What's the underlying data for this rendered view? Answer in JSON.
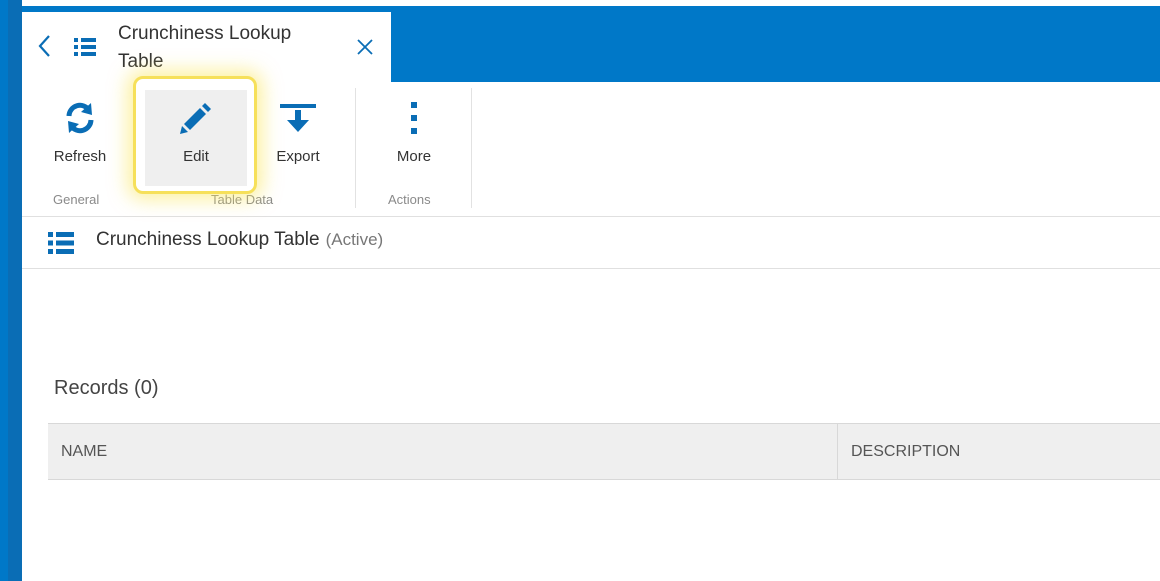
{
  "tab": {
    "title": "Crunchiness Lookup Table"
  },
  "ribbon": {
    "buttons": [
      {
        "label": "Refresh",
        "icon": "refresh-icon"
      },
      {
        "label": "Edit",
        "icon": "pencil-icon"
      },
      {
        "label": "Export",
        "icon": "export-icon"
      },
      {
        "label": "More",
        "icon": "more-vertical-icon"
      }
    ],
    "groups": [
      "General",
      "Table Data",
      "Actions"
    ]
  },
  "subheader": {
    "title": "Crunchiness Lookup Table",
    "status": "(Active)"
  },
  "records": {
    "title": "Records (0)",
    "columns": [
      "NAME",
      "DESCRIPTION"
    ]
  },
  "colors": {
    "brand": "#0078c8",
    "highlight": "#f6e05a"
  }
}
